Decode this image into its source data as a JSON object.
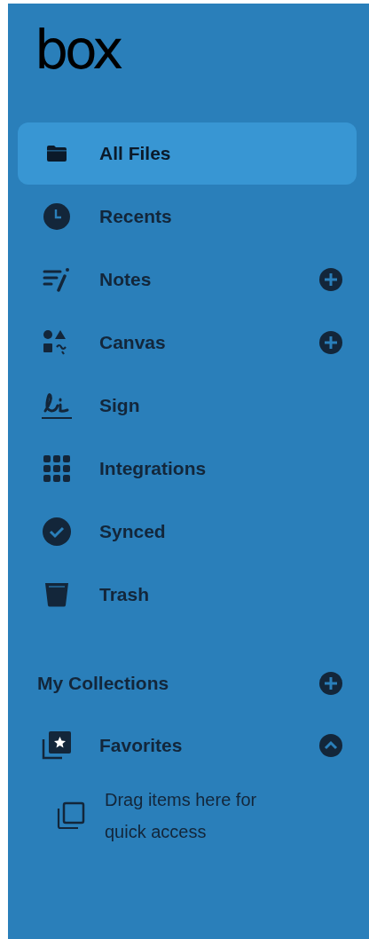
{
  "logo": "box",
  "nav_items": [
    {
      "label": "All Files",
      "selected": true,
      "has_add": false
    },
    {
      "label": "Recents",
      "selected": false,
      "has_add": false
    },
    {
      "label": "Notes",
      "selected": false,
      "has_add": true
    },
    {
      "label": "Canvas",
      "selected": false,
      "has_add": true
    },
    {
      "label": "Sign",
      "selected": false,
      "has_add": false
    },
    {
      "label": "Integrations",
      "selected": false,
      "has_add": false
    },
    {
      "label": "Synced",
      "selected": false,
      "has_add": false
    },
    {
      "label": "Trash",
      "selected": false,
      "has_add": false
    }
  ],
  "collections": {
    "title": "My Collections",
    "items": [
      {
        "label": "Favorites",
        "expanded": true,
        "empty_hint": "Drag items here for quick access"
      }
    ]
  }
}
